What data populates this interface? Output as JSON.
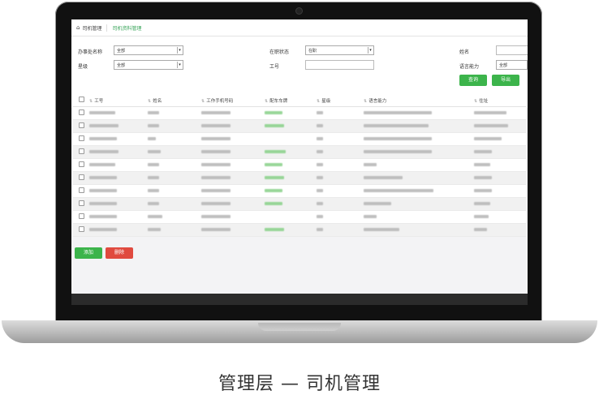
{
  "breadcrumb": {
    "home": "司机管理",
    "current": "司机资料管理"
  },
  "filters": {
    "office_label": "办事处名称",
    "office_value": "全部",
    "level_label": "星级",
    "level_value": "全部",
    "status_label": "在职状态",
    "status_value": "在职",
    "id_label": "工号",
    "name_label": "姓名",
    "language_label": "语言能力",
    "language_value": "全部",
    "query_button": "查询",
    "export_button": "导出"
  },
  "table": {
    "headers": [
      "工号",
      "姓名",
      "工作手机号码",
      "配车车牌",
      "星级",
      "语言能力",
      "住址"
    ]
  },
  "actions": {
    "add_button": "添加",
    "delete_button": "删除"
  },
  "caption": "管理层 — 司机管理",
  "colors": {
    "accent_green": "#3cb44b",
    "delete_red": "#e04a3f"
  }
}
